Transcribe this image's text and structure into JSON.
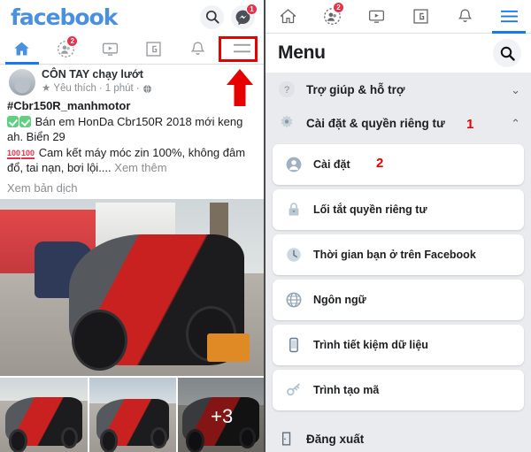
{
  "left": {
    "brand": "facebook",
    "top_actions": [
      {
        "name": "search-icon",
        "badge": null
      },
      {
        "name": "messenger-icon",
        "badge": "1"
      }
    ],
    "tabs": [
      {
        "name": "home-tab",
        "icon": "home-icon",
        "badge": null,
        "active": true
      },
      {
        "name": "friends-tab",
        "icon": "friends-icon",
        "badge": "2",
        "active": false
      },
      {
        "name": "watch-tab",
        "icon": "video-icon",
        "badge": null,
        "active": false
      },
      {
        "name": "marketplace-tab",
        "icon": "marketplace-icon",
        "badge": null,
        "active": false
      },
      {
        "name": "notifications-tab",
        "icon": "bell-icon",
        "badge": null,
        "active": false
      },
      {
        "name": "menu-tab",
        "icon": "hamburger-icon",
        "badge": null,
        "active": false
      }
    ],
    "post": {
      "author": "CÔN TAY chạy lướt",
      "favorite": "Yêu thích",
      "time": "1 phút",
      "privacy_icon": "globe-icon",
      "hashtag": "#Cbr150R_manhmotor",
      "line1": "Bán em HonDa Cbr150R 2018 mới keng ah. Biển 29",
      "line2": "Cam kết máy móc zin 100%, không đâm đổ, tai nạn, bơi lội....",
      "see_more": "Xem thêm",
      "translate": "Xem bản dịch",
      "more_photos": "+3"
    }
  },
  "right": {
    "tabs": [
      {
        "name": "home-tab",
        "icon": "home-icon",
        "badge": null,
        "active": false
      },
      {
        "name": "friends-tab",
        "icon": "friends-icon",
        "badge": "2",
        "active": false
      },
      {
        "name": "watch-tab",
        "icon": "video-icon",
        "badge": null,
        "active": false
      },
      {
        "name": "marketplace-tab",
        "icon": "marketplace-icon",
        "badge": null,
        "active": false
      },
      {
        "name": "notifications-tab",
        "icon": "bell-icon",
        "badge": null,
        "active": false
      },
      {
        "name": "menu-tab",
        "icon": "hamburger-icon",
        "badge": null,
        "active": true
      }
    ],
    "header": {
      "title": "Menu",
      "search_icon": "search-icon"
    },
    "items": [
      {
        "label": "Trợ giúp & hỗ trợ",
        "icon": "question-circle-icon",
        "style": "plain",
        "chevron": "down"
      },
      {
        "label": "Cài đặt & quyền riêng tư",
        "icon": "gear-icon",
        "style": "plain",
        "chevron": "up"
      },
      {
        "label": "Cài đặt",
        "icon": "person-circle-icon",
        "style": "card",
        "chevron": null
      },
      {
        "label": "Lối tắt quyền riêng tư",
        "icon": "lock-icon",
        "style": "card",
        "chevron": null
      },
      {
        "label": "Thời gian bạn ở trên Facebook",
        "icon": "clock-icon",
        "style": "card",
        "chevron": null
      },
      {
        "label": "Ngôn ngữ",
        "icon": "globe-icon",
        "style": "card",
        "chevron": null
      },
      {
        "label": "Trình tiết kiệm dữ liệu",
        "icon": "phone-icon",
        "style": "card",
        "chevron": null
      },
      {
        "label": "Trình tạo mã",
        "icon": "key-icon",
        "style": "card",
        "chevron": null
      },
      {
        "label": "Đăng xuất",
        "icon": "logout-icon",
        "style": "plain",
        "chevron": null
      }
    ],
    "annotations": {
      "step_1": "1",
      "step_2": "2"
    }
  },
  "colors": {
    "fb_blue": "#1877f2",
    "brand_blue": "#4a90e2",
    "badge_red": "#e8304a",
    "annotation_red": "#e60000",
    "panel_bg": "#e9ebee"
  }
}
